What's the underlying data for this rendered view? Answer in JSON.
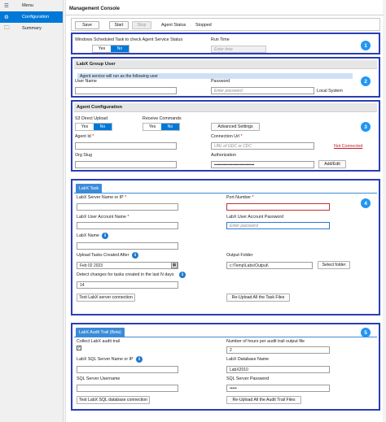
{
  "sidebar": {
    "items": [
      {
        "label": "Menu",
        "icon": "hamburger-icon"
      },
      {
        "label": "Configuration",
        "icon": "gear-icon"
      },
      {
        "label": "Summary",
        "icon": "folder-icon"
      }
    ]
  },
  "page_title": "Management Console",
  "toolbar": {
    "save": "Save",
    "start": "Start",
    "stop": "Stop",
    "agent_status_label": "Agent Status",
    "agent_status_value": "Stopped"
  },
  "scheduled": {
    "label": "Windows Scheduled Task to check Agent Service Status",
    "yes": "Yes",
    "no": "No",
    "run_time_label": "Run Time",
    "run_time_placeholder": "Enter time",
    "badge": "1"
  },
  "group_user": {
    "title": "LabX Group User",
    "banner": "Agent service will run as the following user",
    "user_name_label": "User Name",
    "password_label": "Password",
    "password_placeholder": "Enter password",
    "local_system": "Local System",
    "badge": "2"
  },
  "agent_config": {
    "title": "Agent Configuration",
    "s3_label": "S3 Direct Upload",
    "receive_label": "Receive Commands",
    "yes": "Yes",
    "no": "No",
    "advanced": "Advanced Settings",
    "agent_id_label": "Agent Id",
    "connection_url_label": "Connection Url",
    "connection_url_placeholder": "URL of GDC or CDC",
    "not_connected": "Not Connected",
    "org_slug_label": "Org Slug",
    "authorization_label": "Authorization",
    "authorization_value": "••••••••••••••••••••••••••••••••••••••••••",
    "add_edit": "Add/Edit",
    "badge": "3"
  },
  "labx_task": {
    "tab": "LabX Task",
    "server_label": "LabX Server Name or IP",
    "port_label": "Port Number",
    "account_label": "LabX User Account Name",
    "account_password_label": "LabX User Account Password",
    "account_password_placeholder": "Enter password",
    "labx_name_label": "LabX Name",
    "upload_after_label": "Upload Tasks Created After",
    "upload_after_value": "Feb 02 2023",
    "output_folder_label": "Output Folder",
    "output_folder_value": "c:\\Temp\\Labx\\Output\\",
    "select_folder": "Select folder",
    "detect_label": "Detect changes for tasks created in the last N days",
    "detect_value": "14",
    "test_button": "Test LabX server connection",
    "reupload_button": "Re-Upload All the Task Files",
    "badge": "4"
  },
  "audit_trail": {
    "tab": "LabX Audit Trail (Beta)",
    "collect_label": "Collect LabX audit trail",
    "hours_label": "Number of hours per audit trail output file",
    "hours_value": "2",
    "sql_server_label": "LabX SQL Server Name or IP",
    "db_name_label": "LabX Database Name",
    "db_name_value": "LabX2010",
    "sql_user_label": "SQL Server Username",
    "sql_password_label": "SQL Server Password",
    "sql_password_value": "•••••",
    "test_button": "Test LabX SQL database connection",
    "reupload_button": "Re-Upload All the Audit Trail Files",
    "badge": "5"
  },
  "colors": {
    "accent": "#0078d7",
    "highlight_border": "#2a3eb5",
    "badge": "#2196f3",
    "error": "#c0202a"
  }
}
